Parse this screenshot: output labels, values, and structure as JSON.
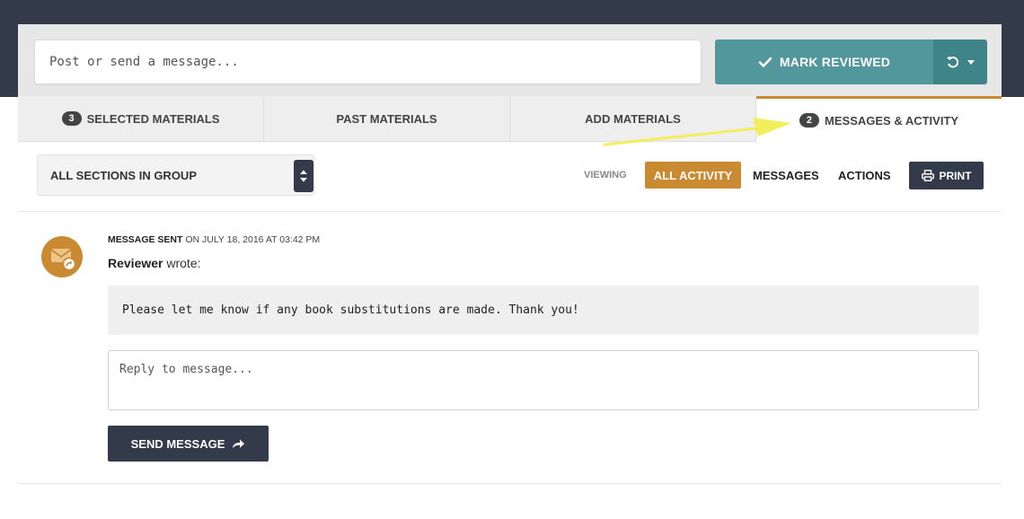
{
  "composer": {
    "placeholder": "Post or send a message...",
    "mark_reviewed_label": "MARK REVIEWED"
  },
  "tabs": [
    {
      "badge": "3",
      "label": "SELECTED MATERIALS"
    },
    {
      "label": "PAST MATERIALS"
    },
    {
      "label": "ADD MATERIALS"
    },
    {
      "badge": "2",
      "label": "MESSAGES & ACTIVITY"
    }
  ],
  "toolbar": {
    "section_select_value": "ALL SECTIONS IN GROUP",
    "viewing_label": "VIEWING",
    "filters": [
      "ALL ACTIVITY",
      "MESSAGES",
      "ACTIONS"
    ],
    "print_label": "PRINT"
  },
  "message": {
    "status": "MESSAGE SENT",
    "date_text": "ON JULY 18, 2016 AT 03:42 PM",
    "author": "Reviewer",
    "wrote": "wrote:",
    "body": "Please let me know if any book substitutions are made. Thank you!",
    "reply_placeholder": "Reply to message...",
    "send_label": "SEND MESSAGE"
  },
  "colors": {
    "navy": "#333a49",
    "teal": "#52979c",
    "accent_orange": "#c98a32",
    "annotation_arrow": "#f2ee5c"
  },
  "icons": [
    "check-icon",
    "refresh-icon",
    "caret-down-icon",
    "select-arrows-icon",
    "print-icon",
    "envelope-icon",
    "share-icon"
  ]
}
